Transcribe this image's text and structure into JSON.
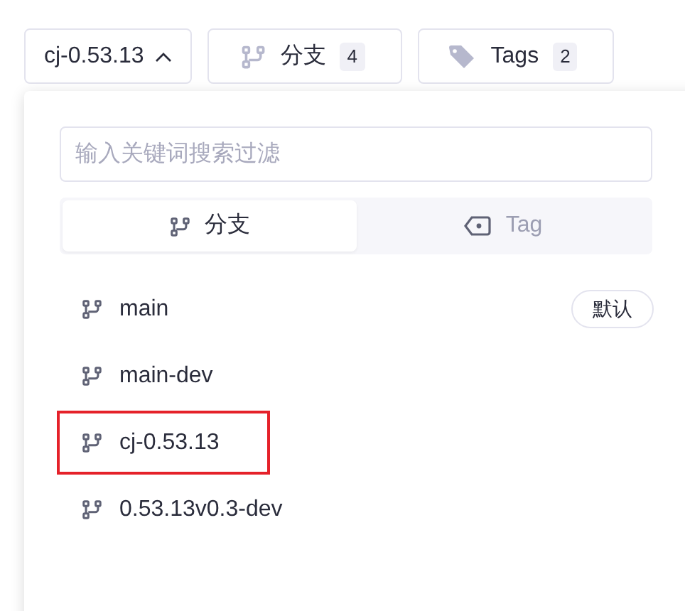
{
  "toolbar": {
    "current_branch": {
      "label": "cj-0.53.13",
      "expanded": true
    },
    "branches_button": {
      "label": "分支",
      "count": "4"
    },
    "tags_button": {
      "label": "Tags",
      "count": "2"
    }
  },
  "dropdown": {
    "search": {
      "placeholder": "输入关键词搜索过滤"
    },
    "tabs": [
      {
        "label": "分支",
        "kind": "branch",
        "selected": true
      },
      {
        "label": "Tag",
        "kind": "tag",
        "selected": false
      }
    ],
    "branches": [
      {
        "name": "main",
        "badge": "默认",
        "highlighted": false
      },
      {
        "name": "main-dev",
        "highlighted": false
      },
      {
        "name": "cj-0.53.13",
        "highlighted": true
      },
      {
        "name": "0.53.13v0.3-dev",
        "highlighted": false
      }
    ]
  }
}
